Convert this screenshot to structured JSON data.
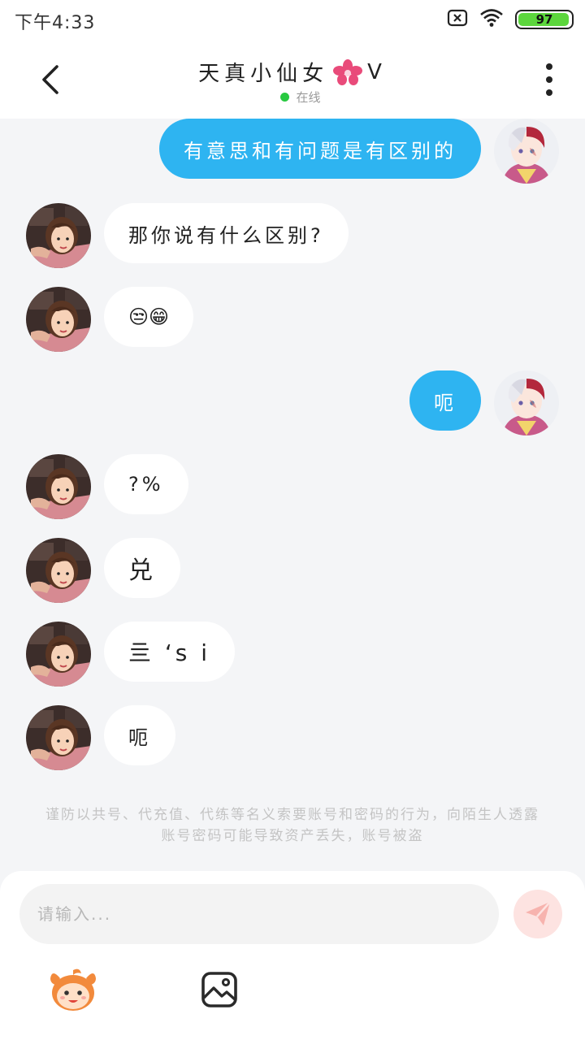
{
  "status_bar": {
    "time": "下午4:33",
    "battery": "97",
    "battery_level": 0.97
  },
  "header": {
    "title": "天真小仙女",
    "title_suffix": "V",
    "status": "在线"
  },
  "messages": [
    {
      "side": "right",
      "text": "有意思和有问题是有区别的",
      "avatar": "male-anime-avatar"
    },
    {
      "side": "left",
      "text": "那你说有什么区别?",
      "avatar": "female-cartoon-avatar"
    },
    {
      "side": "left",
      "text": "😒😁",
      "avatar": "female-cartoon-avatar"
    },
    {
      "side": "right",
      "text": "呃",
      "avatar": "male-anime-avatar"
    },
    {
      "side": "left",
      "text": "?%",
      "avatar": "female-cartoon-avatar"
    },
    {
      "side": "left",
      "text": "兑",
      "avatar": "female-cartoon-avatar"
    },
    {
      "side": "left",
      "text": "亖 ‘s i",
      "avatar": "female-cartoon-avatar"
    },
    {
      "side": "left",
      "text": "呃",
      "avatar": "female-cartoon-avatar"
    }
  ],
  "notice": "谨防以共号、代充值、代练等名义索要账号和密码的行为，向陌生人透露账号密码可能导致资产丢失，账号被盗",
  "input": {
    "placeholder": "请输入...",
    "value": ""
  },
  "colors": {
    "accent": "#2eb4f1",
    "online": "#28c940",
    "battery": "#5cd63d",
    "send_button": "#fde3e1"
  },
  "icons": [
    "back-icon",
    "sakura-icon",
    "more-icon",
    "send-icon",
    "emoji-mascot-icon",
    "image-icon",
    "wifi-icon",
    "sim-off-icon"
  ]
}
